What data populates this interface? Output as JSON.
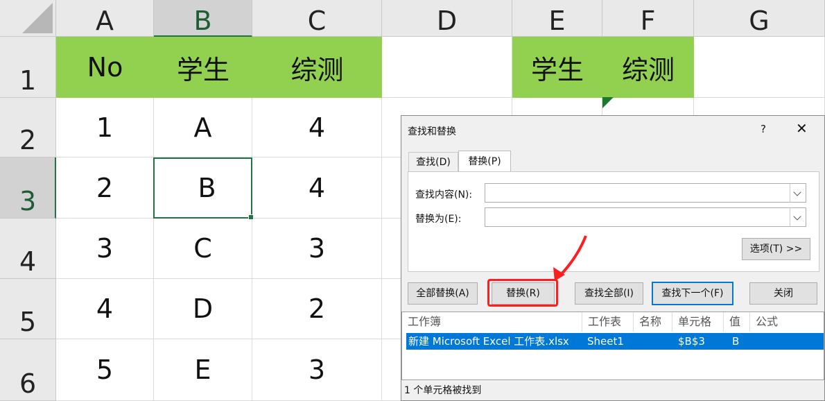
{
  "columns": [
    "A",
    "B",
    "C",
    "D",
    "E",
    "F",
    "G"
  ],
  "rows": [
    "1",
    "2",
    "3",
    "4",
    "5",
    "6"
  ],
  "cells": {
    "r1": [
      "No",
      "学生",
      "综测",
      "",
      "学生",
      "综测",
      ""
    ],
    "r2": [
      "1",
      "A",
      "4",
      "",
      "",
      "",
      ""
    ],
    "r3": [
      "2",
      "B",
      "4",
      "",
      "",
      "",
      ""
    ],
    "r4": [
      "3",
      "C",
      "3",
      "",
      "",
      "",
      ""
    ],
    "r5": [
      "4",
      "D",
      "2",
      "",
      "",
      "",
      ""
    ],
    "r6": [
      "5",
      "E",
      "3",
      "",
      "",
      "",
      ""
    ]
  },
  "colors": {
    "header_fill": "#92d050",
    "selection": "#217346",
    "accent": "#0078d7",
    "highlight_box": "#ff1e1e"
  },
  "dialog": {
    "title": "查找和替换",
    "help": "?",
    "close": "✕",
    "tabs": {
      "find": "查找(D)",
      "replace": "替换(P)"
    },
    "find_label": "查找内容(N):",
    "replace_label": "替换为(E):",
    "find_value": "",
    "replace_value": "",
    "options_button": "选项(T) >>",
    "buttons": {
      "replace_all": "全部替换(A)",
      "replace": "替换(R)",
      "find_all": "查找全部(I)",
      "find_next": "查找下一个(F)",
      "close": "关闭"
    },
    "results_headers": [
      "工作簿",
      "工作表",
      "名称",
      "单元格",
      "值",
      "公式"
    ],
    "results_row": {
      "workbook": "新建 Microsoft Excel 工作表.xlsx",
      "sheet": "Sheet1",
      "name": "",
      "cell": "$B$3",
      "value": "B",
      "formula": ""
    },
    "status": "1 个单元格被找到"
  }
}
